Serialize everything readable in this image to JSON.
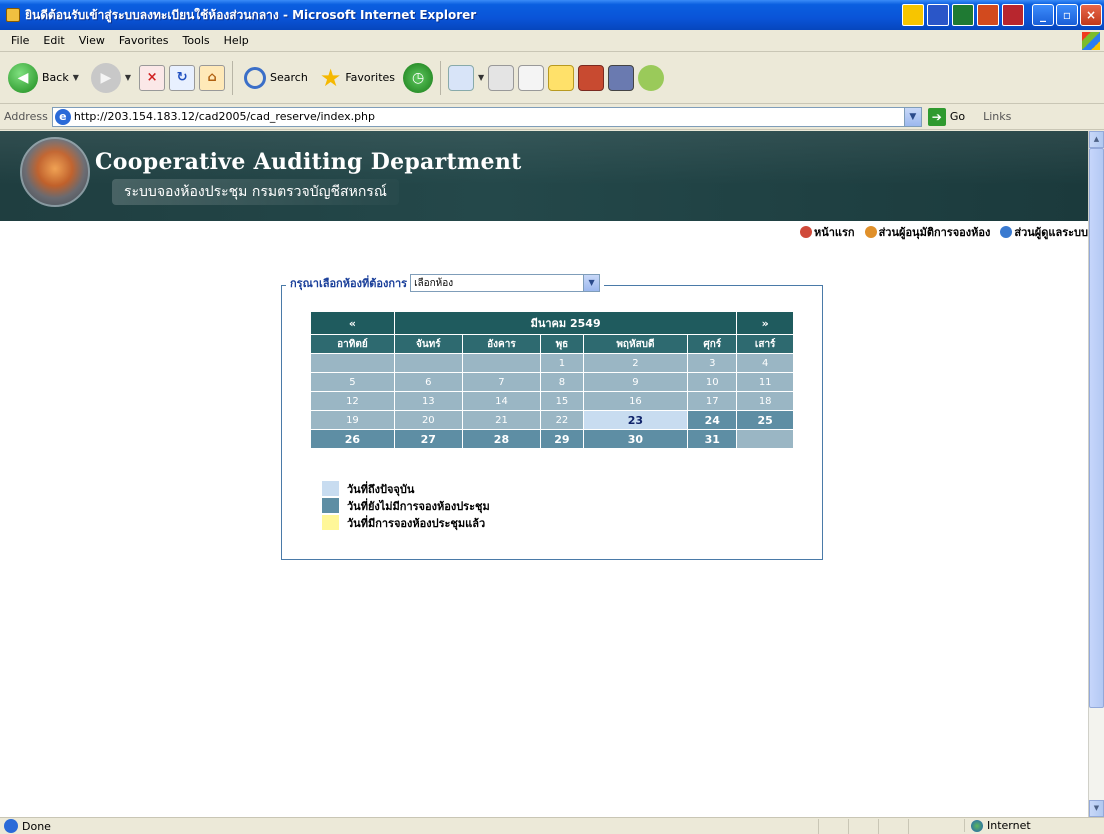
{
  "window": {
    "title": "ยินดีต้อนรับเข้าสู่ระบบลงทะเบียนใช้ห้องส่วนกลาง - Microsoft Internet Explorer"
  },
  "menubar": {
    "items": [
      "File",
      "Edit",
      "View",
      "Favorites",
      "Tools",
      "Help"
    ]
  },
  "toolbar": {
    "back_label": "Back",
    "search_label": "Search",
    "favorites_label": "Favorites"
  },
  "addressbar": {
    "label": "Address",
    "url": "http://203.154.183.12/cad2005/cad_reserve/index.php",
    "go_label": "Go",
    "links_label": "Links"
  },
  "banner": {
    "title": "Cooperative Auditing Department",
    "subtitle": "ระบบจองห้องประชุม กรมตรวจบัญชีสหกรณ์"
  },
  "topnav": {
    "home": "หน้าแรก",
    "approver": "ส่วนผู้อนุมัติการจองห้อง",
    "admin": "ส่วนผู้ดูแลระบบ"
  },
  "room_select": {
    "prompt": "กรุณาเลือกห้องที่ต้องการ",
    "selected": "เลือกห้อง"
  },
  "calendar": {
    "prev": "«",
    "next": "»",
    "month_title": "มีนาคม 2549",
    "weekdays": [
      "อาทิตย์",
      "จันทร์",
      "อังคาร",
      "พุธ",
      "พฤหัสบดี",
      "ศุกร์",
      "เสาร์"
    ],
    "weeks": [
      [
        "",
        "",
        "",
        "1",
        "2",
        "3",
        "4"
      ],
      [
        "5",
        "6",
        "7",
        "8",
        "9",
        "10",
        "11"
      ],
      [
        "12",
        "13",
        "14",
        "15",
        "16",
        "17",
        "18"
      ],
      [
        "19",
        "20",
        "21",
        "22",
        "23",
        "24",
        "25"
      ],
      [
        "26",
        "27",
        "28",
        "29",
        "30",
        "31",
        ""
      ]
    ],
    "today": "23"
  },
  "legend": {
    "today": "วันที่ถึงปัจจุบัน",
    "available": "วันที่ยังไม่มีการจองห้องประชุม",
    "booked": "วันที่มีการจองห้องประชุมแล้ว"
  },
  "colors": {
    "today": "#c8dcf0",
    "available": "#5e8ea4",
    "booked": "#fff799"
  },
  "statusbar": {
    "text": "Done",
    "zone": "Internet"
  }
}
